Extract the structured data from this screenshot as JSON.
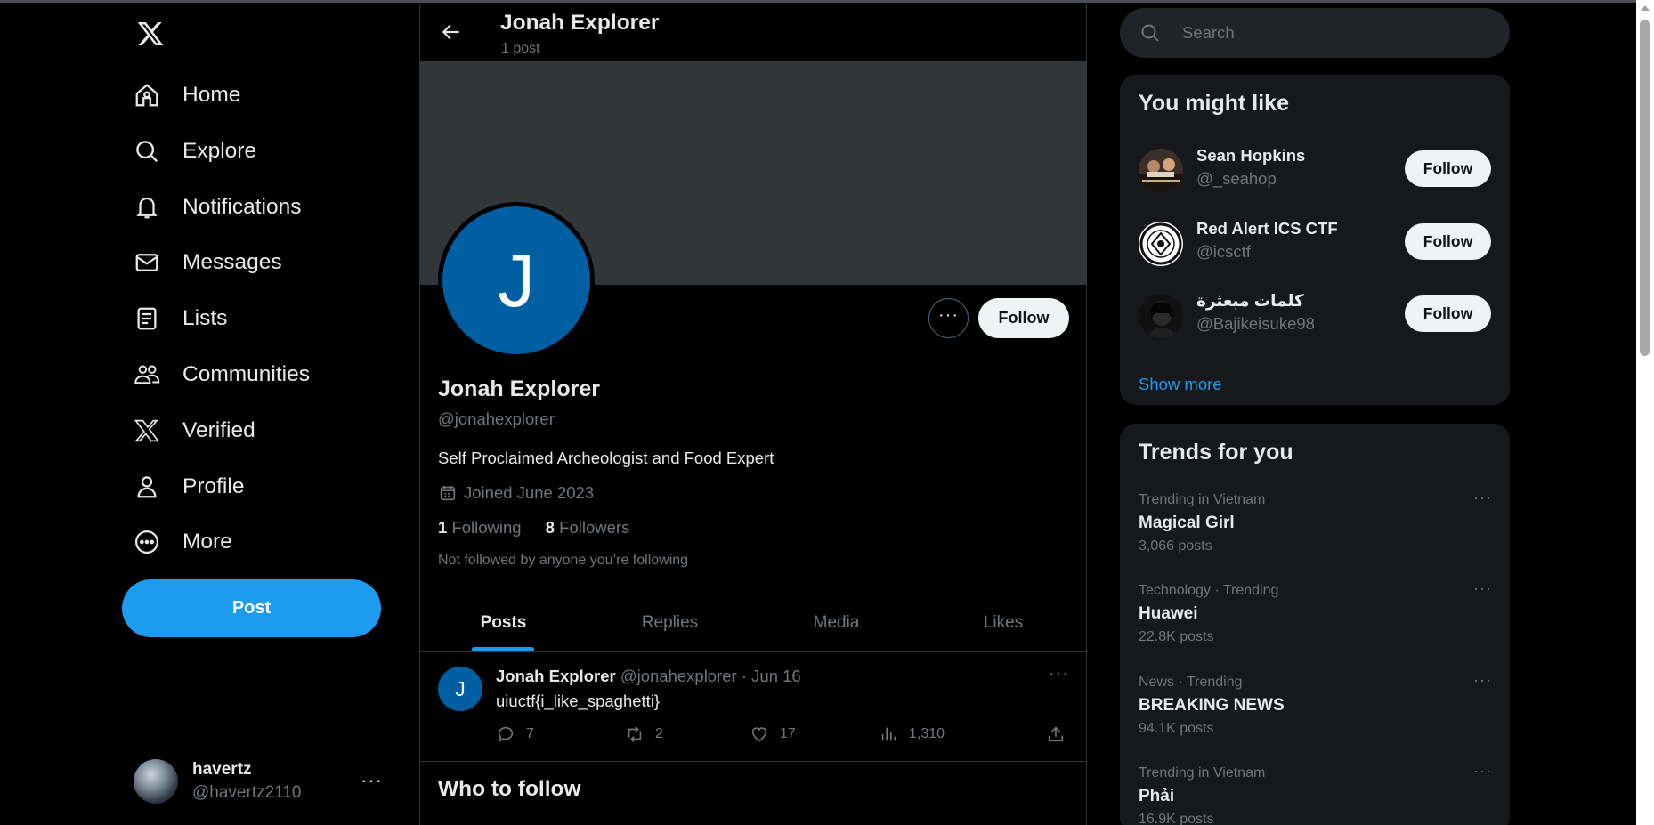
{
  "nav": {
    "items": [
      {
        "label": "Home",
        "icon": "home-icon"
      },
      {
        "label": "Explore",
        "icon": "search-icon"
      },
      {
        "label": "Notifications",
        "icon": "bell-icon"
      },
      {
        "label": "Messages",
        "icon": "envelope-icon"
      },
      {
        "label": "Lists",
        "icon": "list-icon"
      },
      {
        "label": "Communities",
        "icon": "people-icon"
      },
      {
        "label": "Verified",
        "icon": "x-logo-icon"
      },
      {
        "label": "Profile",
        "icon": "person-icon"
      },
      {
        "label": "More",
        "icon": "more-circle-icon"
      }
    ],
    "post_label": "Post",
    "account": {
      "name": "havertz",
      "handle": "@havertz2110",
      "more": "···"
    }
  },
  "header": {
    "title": "Jonah Explorer",
    "subtitle": "1 post"
  },
  "profile": {
    "avatar_letter": "J",
    "more": "···",
    "follow_label": "Follow",
    "name": "Jonah Explorer",
    "handle": "@jonahexplorer",
    "bio": "Self Proclaimed Archeologist and Food Expert",
    "joined": "Joined June 2023",
    "following_count": "1",
    "following_label": "Following",
    "followers_count": "8",
    "followers_label": "Followers",
    "not_followed": "Not followed by anyone you’re following"
  },
  "tabs": [
    "Posts",
    "Replies",
    "Media",
    "Likes"
  ],
  "tweet": {
    "avatar_letter": "J",
    "name": "Jonah Explorer",
    "handle": "@jonahexplorer",
    "dot": "·",
    "date": "Jun 16",
    "more": "···",
    "text": "uiuctf{i_like_spaghetti}",
    "replies": "7",
    "reposts": "2",
    "likes": "17",
    "views": "1,310"
  },
  "who_to_follow_title": "Who to follow",
  "search": {
    "placeholder": "Search"
  },
  "you_might_like": {
    "title": "You might like",
    "users": [
      {
        "name": "Sean Hopkins",
        "handle": "@_seahop",
        "follow": "Follow"
      },
      {
        "name": "Red Alert ICS CTF",
        "handle": "@icsctf",
        "follow": "Follow"
      },
      {
        "name": "كلمات مبعثرة",
        "handle": "@Bajikeisuke98",
        "follow": "Follow"
      }
    ],
    "show_more": "Show more"
  },
  "trends": {
    "title": "Trends for you",
    "more": "···",
    "items": [
      {
        "context": "Trending in Vietnam",
        "title": "Magical Girl",
        "posts": "3,066 posts"
      },
      {
        "context": "Technology · Trending",
        "title": "Huawei",
        "posts": "22.8K posts"
      },
      {
        "context": "News · Trending",
        "title": "BREAKING NEWS",
        "posts": "94.1K posts"
      },
      {
        "context": "Trending in Vietnam",
        "title": "Phải",
        "posts": "16.9K posts"
      }
    ]
  },
  "colors": {
    "accent": "#1d9bf0",
    "background": "#000000",
    "card": "#16181c",
    "banner": "#333639",
    "avatar": "#005fa3"
  }
}
